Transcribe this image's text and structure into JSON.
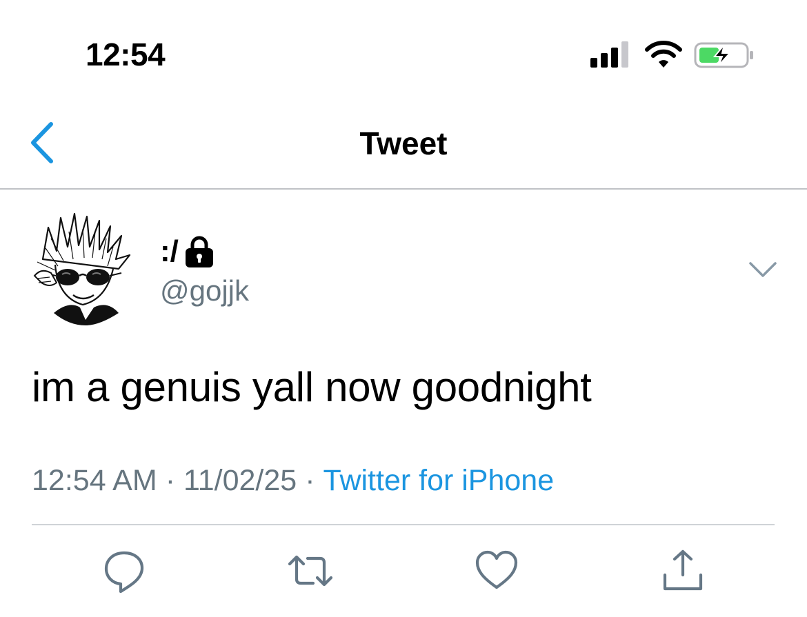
{
  "status_bar": {
    "time": "12:54",
    "icons": [
      "cellular-signal-icon",
      "wifi-icon",
      "battery-charging-icon"
    ],
    "battery_color": "#4cd964"
  },
  "nav": {
    "back_icon": "chevron-left-icon",
    "title": "Tweet"
  },
  "tweet": {
    "display_name": ":/",
    "protected_icon": "lock-icon",
    "handle": "@gojjk",
    "text": "im a genuis yall now goodnight",
    "time": "12:54 AM",
    "date": "11/02/25",
    "separator": "·",
    "source": "Twitter for iPhone",
    "more_icon": "chevron-down-icon"
  },
  "actions": [
    "reply-icon",
    "retweet-icon",
    "like-icon",
    "share-icon"
  ],
  "colors": {
    "accent": "#1b95e0",
    "secondary_text": "#66757f",
    "icon_gray": "#657786"
  }
}
